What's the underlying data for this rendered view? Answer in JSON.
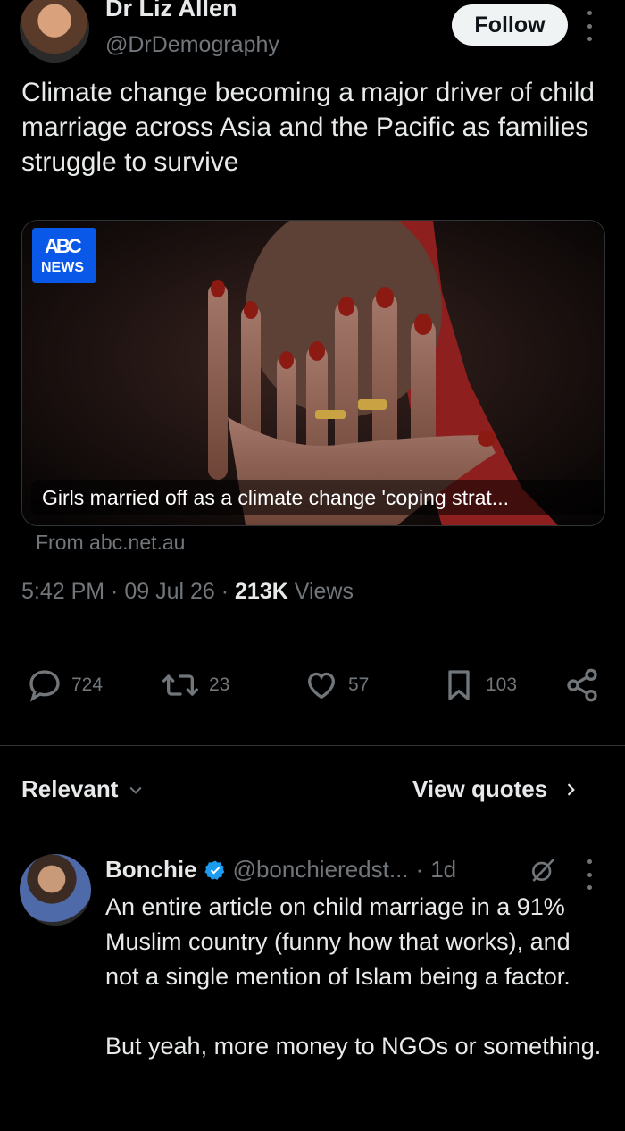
{
  "tweet": {
    "author_name": "Dr Liz Allen",
    "author_handle": "@DrDemography",
    "follow_label": "Follow",
    "text": "Climate change becoming a major driver of child marriage across Asia and the Pacific as families struggle to survive",
    "card": {
      "logo_mark": "ABC",
      "logo_word": "NEWS",
      "caption": "Girls married off as a climate change 'coping strat..."
    },
    "source": "From abc.net.au",
    "time": "5:42 PM",
    "date": "09 Jul 26",
    "views_count": "213K",
    "views_label": "Views"
  },
  "actions": {
    "replies": "724",
    "reposts": "23",
    "likes": "57",
    "bookmarks": "103"
  },
  "replies_header": {
    "sort_label": "Relevant",
    "view_quotes_label": "View quotes"
  },
  "reply": {
    "name": "Bonchie",
    "handle": "@bonchieredst...",
    "time": "1d",
    "paragraph1": "An entire article on child marriage in a 91% Muslim country (funny how that works), and not a single mention of Islam being a factor.",
    "paragraph2": "But yeah, more money to NGOs or something."
  },
  "colors": {
    "background": "#000000",
    "text_primary": "#e7e9ea",
    "text_secondary": "#71767b",
    "verified_blue": "#1d9bf0",
    "abc_blue": "#0a58e8"
  }
}
